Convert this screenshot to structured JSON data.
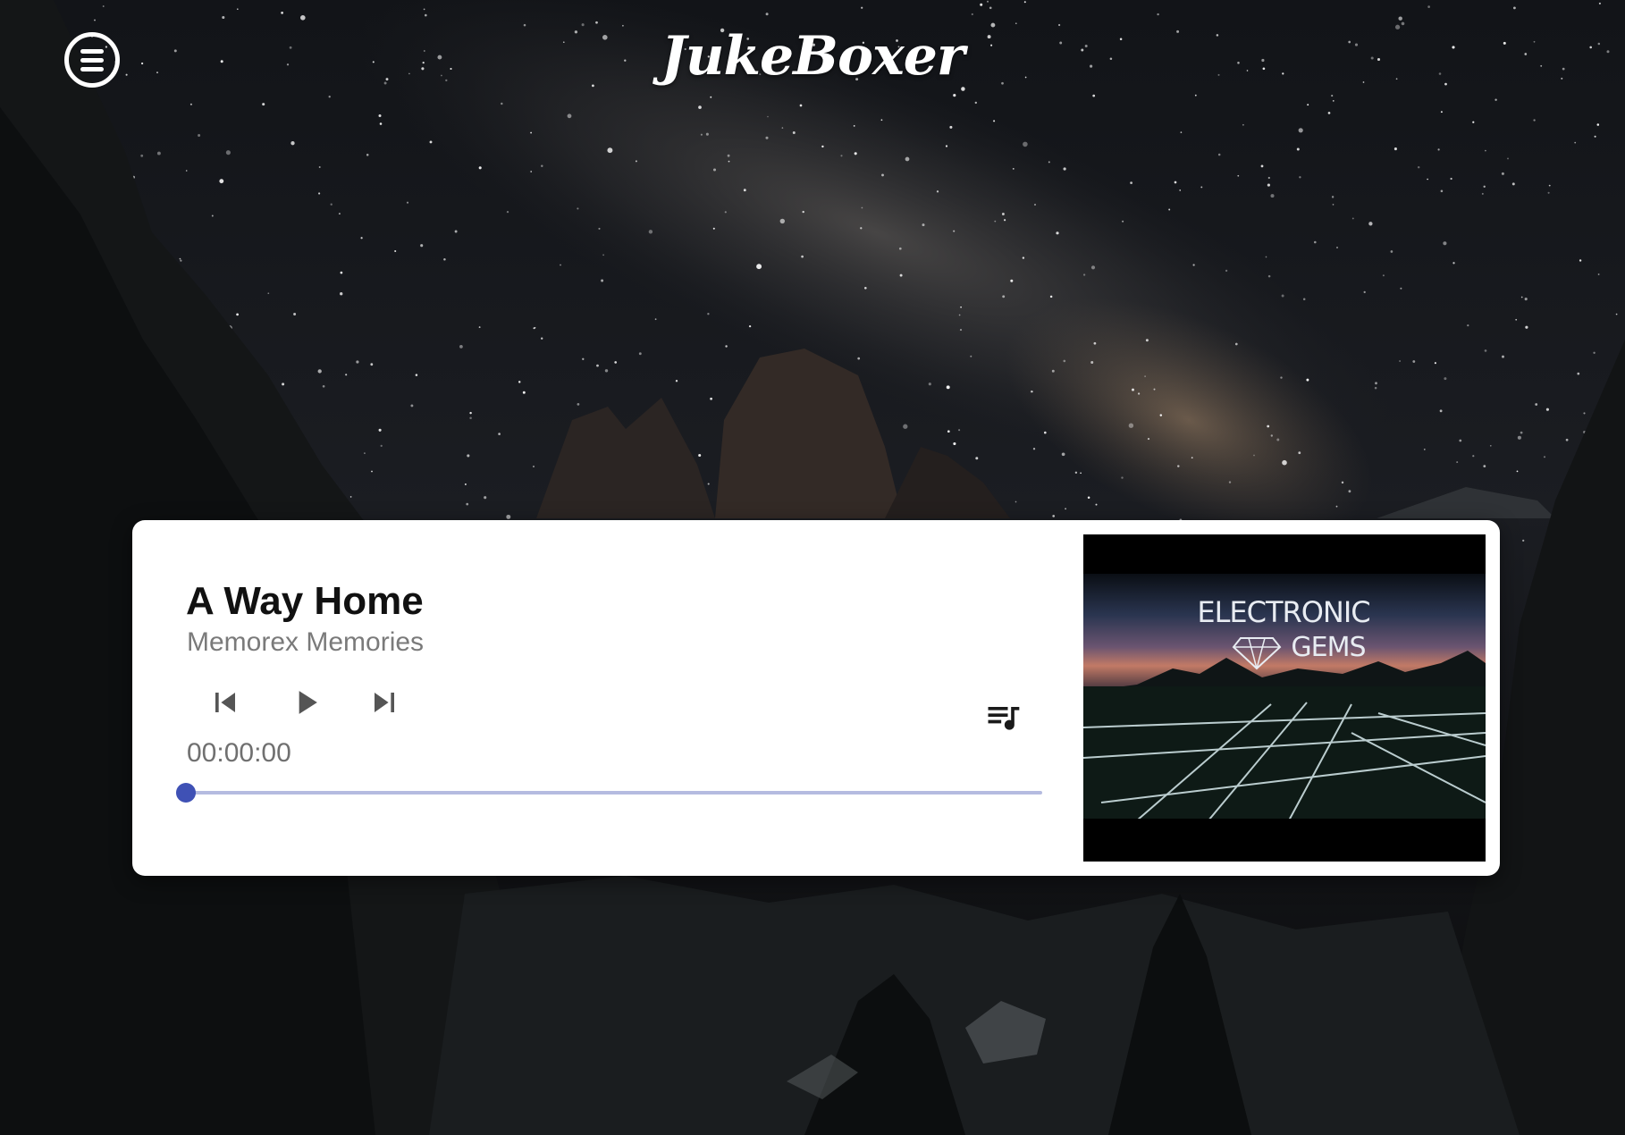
{
  "header": {
    "menu_icon": "hamburger-menu-icon",
    "logo_text": "JukeBoxer"
  },
  "player": {
    "track_title": "A Way Home",
    "artist": "Memorex Memories",
    "elapsed_time": "00:00:00",
    "progress_fraction": 0,
    "controls": {
      "previous_icon": "skip-previous-icon",
      "play_icon": "play-icon",
      "next_icon": "skip-next-icon",
      "queue_icon": "queue-music-icon"
    },
    "album_art_text": "ELECTRONIC GEMS"
  },
  "colors": {
    "accent": "#3f51b5",
    "track": "#b5bbe0",
    "card": "#ffffff"
  }
}
